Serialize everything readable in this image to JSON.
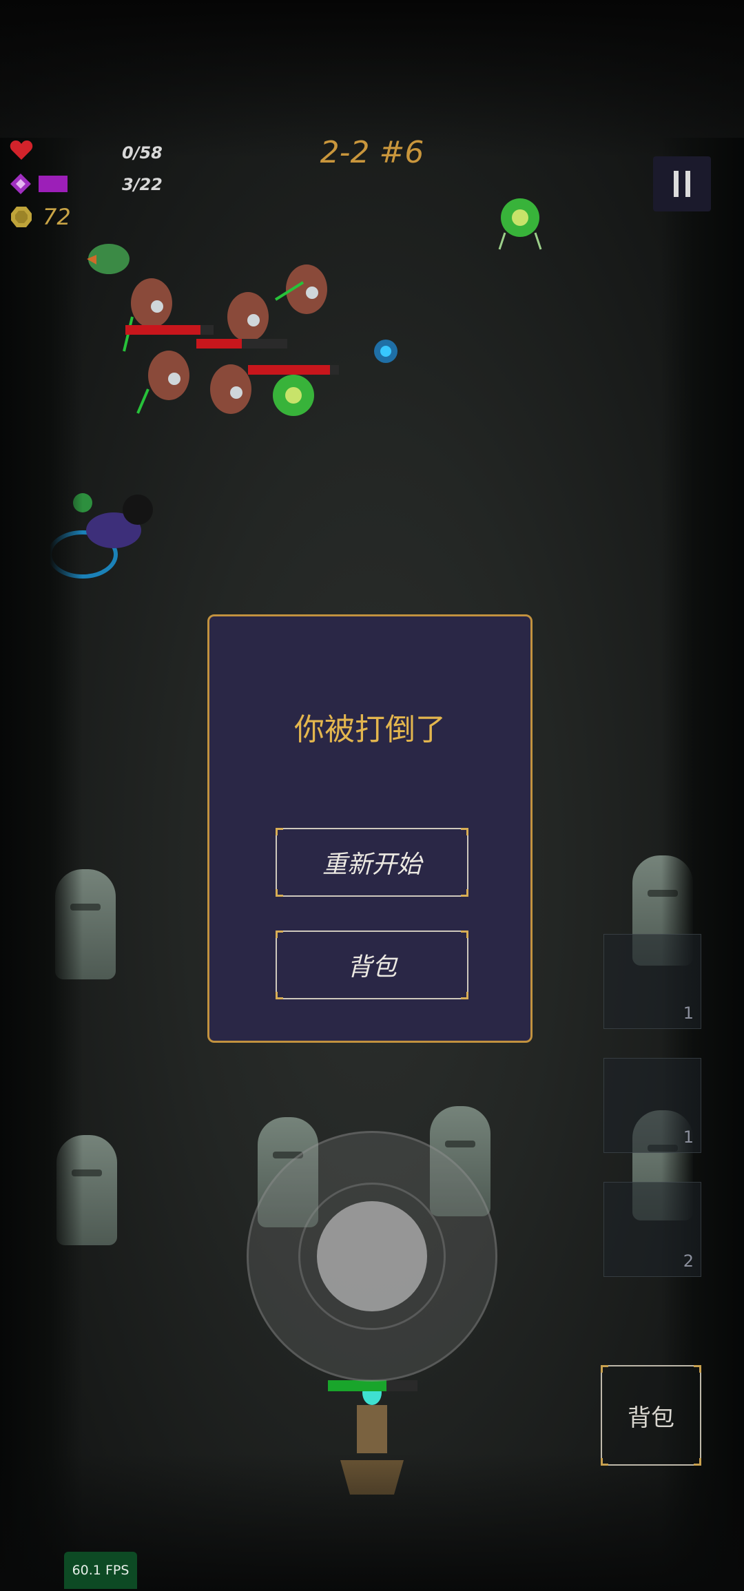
{
  "hud": {
    "hp_text": "0/58",
    "hp": 0,
    "hp_max": 58,
    "mana_text": "3/22",
    "mana": 3,
    "mana_max": 22,
    "gold": "72",
    "level": "2-2 #6"
  },
  "icons": {
    "heart": "heart-icon",
    "mana": "diamond-icon",
    "gold": "coin-icon",
    "pause": "pause-icon"
  },
  "dialog": {
    "title": "你被打倒了",
    "restart_label": "重新开始",
    "bag_label": "背包"
  },
  "side": {
    "bag_label": "背包",
    "slots": [
      {
        "count": "1"
      },
      {
        "count": "1"
      },
      {
        "count": "2"
      }
    ]
  },
  "fps": "60.1 FPS",
  "player": {
    "hp_fraction": 0.65
  },
  "enemy_hp_fractions": [
    0.85,
    0.5,
    0.9
  ],
  "colors": {
    "accent_gold": "#c2923f",
    "dialog_bg": "#2a2746",
    "hp_red": "#c8161c",
    "mana_purple": "#9c1fb8",
    "player_green": "#19a52b"
  }
}
